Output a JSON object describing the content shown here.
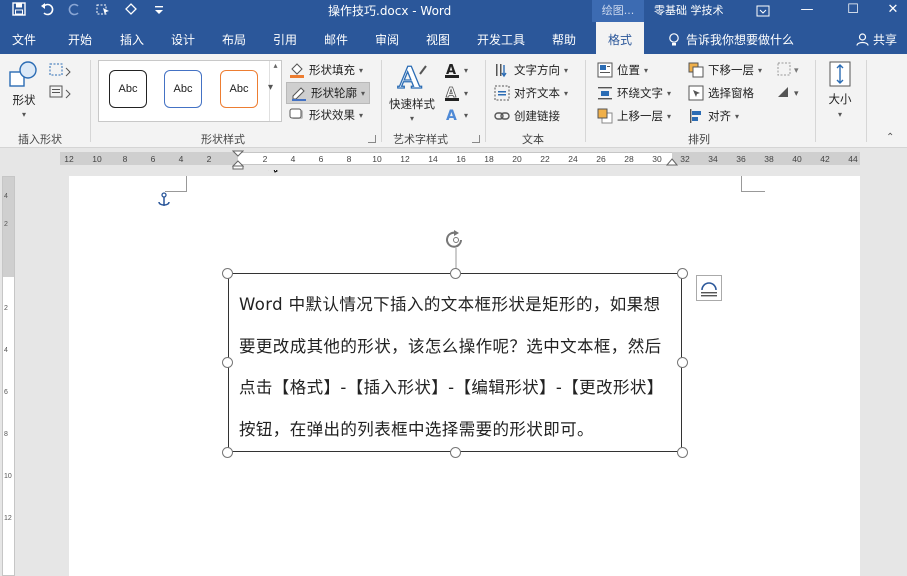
{
  "window": {
    "title": "操作技巧.docx  -  Word",
    "context_tab_group": "绘图...",
    "user": "零基础 学技术",
    "min_glyph": "—",
    "max_glyph": "☐",
    "close_glyph": "✕",
    "brand_color": "#2b579a"
  },
  "quick_access": {
    "icons": [
      "save-icon",
      "undo-icon",
      "redo-icon",
      "select-icon",
      "select-objects-icon",
      "customize-icon"
    ]
  },
  "tabs": [
    "文件",
    "开始",
    "插入",
    "设计",
    "布局",
    "引用",
    "邮件",
    "审阅",
    "视图",
    "开发工具",
    "帮助",
    "格式"
  ],
  "active_tab": "格式",
  "tell_me": "告诉我你想要做什么",
  "share": "共享",
  "ribbon": {
    "insert_shapes": {
      "shapes_label": "形状",
      "group_label": "插入形状"
    },
    "shape_styles": {
      "gallery": [
        "Abc",
        "Abc",
        "Abc"
      ],
      "fill": "形状填充",
      "outline": "形状轮廓",
      "effects": "形状效果",
      "group_label": "形状样式"
    },
    "wordart": {
      "quick_styles": "快速样式",
      "group_label": "艺术字样式"
    },
    "text": {
      "direction": "文字方向",
      "align": "对齐文本",
      "link": "创建链接",
      "group_label": "文本"
    },
    "arrange": {
      "position": "位置",
      "wrap": "环绕文字",
      "forward": "上移一层",
      "backward": "下移一层",
      "selection_pane": "选择窗格",
      "align": "对齐",
      "group_label": "排列"
    },
    "size": {
      "label": "大小"
    }
  },
  "ruler": {
    "left_ticks": [
      "12",
      "10",
      "8",
      "6",
      "4",
      "2"
    ],
    "right_ticks": [
      "2",
      "4",
      "6",
      "8",
      "10",
      "12",
      "14",
      "16",
      "18",
      "20",
      "22",
      "24",
      "26",
      "28",
      "30",
      "32",
      "34",
      "36",
      "38",
      "40",
      "42",
      "44"
    ],
    "vertical_ticks": [
      "4",
      "2",
      "2",
      "4",
      "6",
      "8",
      "10",
      "12"
    ]
  },
  "document": {
    "textbox_text": "Word 中默认情况下插入的文本框形状是矩形的，如果想要更改成其他的形状，该怎么操作呢？选中文本框，然后点击【格式】-【插入形状】-【编辑形状】-【更改形状】按钮，在弹出的列表框中选择需要的形状即可。"
  }
}
